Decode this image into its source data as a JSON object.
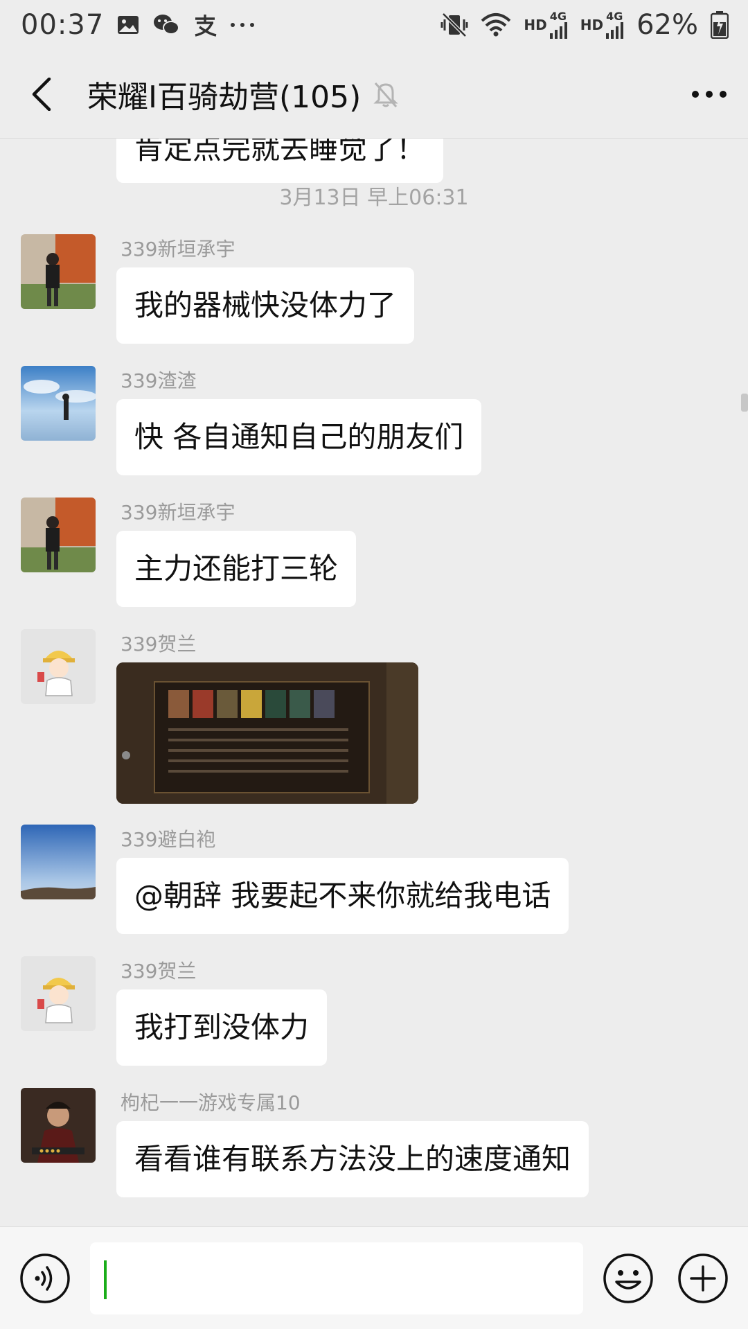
{
  "status_bar": {
    "time": "00:37",
    "icons": [
      "image-icon",
      "wechat-icon",
      "alipay-icon",
      "more-dots-icon"
    ],
    "right_icons": [
      "vibrate-mute-icon",
      "wifi-icon",
      "hd-4g-signal-icon",
      "hd-4g-signal-icon",
      "battery-icon"
    ],
    "hd_label": "HD",
    "net_label": "4G",
    "battery": "62%"
  },
  "header": {
    "title": "荣耀I百骑劫营(105)",
    "icons": [
      "back-arrow-icon",
      "mute-bell-icon",
      "more-horizontal-icon"
    ]
  },
  "chat": {
    "partial_top": "肯定点完就去睡觉了！",
    "timestamp": "3月13日 早上06:31",
    "messages": [
      {
        "sender": "339新垣承宇",
        "text": "我的器械快没体力了"
      },
      {
        "sender": "339渣渣",
        "text": "快 各自通知自己的朋友们"
      },
      {
        "sender": "339新垣承宇",
        "text": "主力还能打三轮"
      },
      {
        "sender": "339贺兰",
        "text": ""
      },
      {
        "sender": "339避白袍",
        "text": "@朝辞  我要起不来你就给我电话"
      },
      {
        "sender": "339贺兰",
        "text": "我打到没体力"
      },
      {
        "sender": "枸杞一一游戏专属10",
        "text": "看看谁有联系方法没上的速度通知"
      }
    ]
  },
  "input_bar": {
    "icons": [
      "voice-icon",
      "emoji-icon",
      "plus-icon"
    ],
    "value": ""
  },
  "colors": {
    "background": "#ededed",
    "bubble": "#ffffff",
    "caret": "#1aad19",
    "sender_name": "#9a9a9a"
  }
}
